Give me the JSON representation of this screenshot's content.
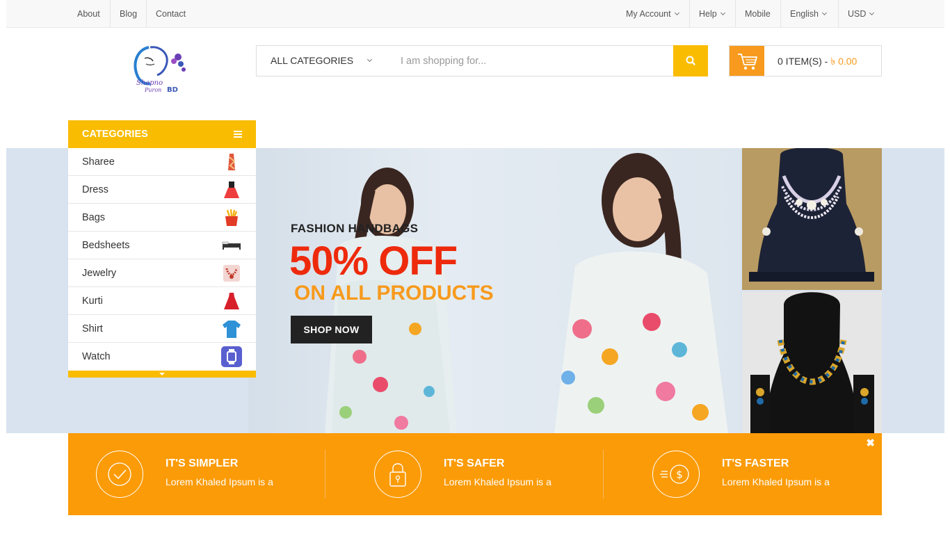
{
  "topbar": {
    "left_links": [
      "About",
      "Blog",
      "Contact"
    ],
    "my_account": "My Account",
    "help": "Help",
    "mobile": "Mobile",
    "language": "English",
    "currency": "USD"
  },
  "logo": {
    "text_line1": "Shapno",
    "text_line2": "Puron",
    "text_line3": "BD"
  },
  "search": {
    "category_label": "ALL CATEGORIES",
    "placeholder": "I am shopping for..."
  },
  "cart": {
    "items_text": "0 ITEM(S) - ",
    "price": "৳ 0.00"
  },
  "categories": {
    "header": "CATEGORIES",
    "items": [
      {
        "label": "Sharee",
        "icon": "sharee-icon"
      },
      {
        "label": "Dress",
        "icon": "dress-icon"
      },
      {
        "label": "Bags",
        "icon": "bags-icon"
      },
      {
        "label": "Bedsheets",
        "icon": "bedsheet-icon"
      },
      {
        "label": "Jewelry",
        "icon": "jewelry-icon"
      },
      {
        "label": "Kurti",
        "icon": "kurti-icon"
      },
      {
        "label": "Shirt",
        "icon": "shirt-icon"
      },
      {
        "label": "Watch",
        "icon": "watch-icon"
      }
    ]
  },
  "hero": {
    "subtitle": "FASHION HANDBAGS",
    "headline": "50% OFF",
    "tagline": "ON ALL PRODUCTS",
    "button": "SHOP NOW"
  },
  "features": [
    {
      "title": "IT'S SIMPLER",
      "desc": "Lorem Khaled Ipsum is a",
      "icon": "check-icon"
    },
    {
      "title": "IT'S SAFER",
      "desc": "Lorem Khaled Ipsum is a",
      "icon": "lock-icon"
    },
    {
      "title": "IT'S FASTER",
      "desc": "Lorem Khaled Ipsum is a",
      "icon": "dollar-icon"
    }
  ],
  "colors": {
    "accent_yellow": "#f9bc00",
    "accent_orange": "#fb9b07",
    "sale_red": "#ee2a0c",
    "dark": "#222222"
  }
}
